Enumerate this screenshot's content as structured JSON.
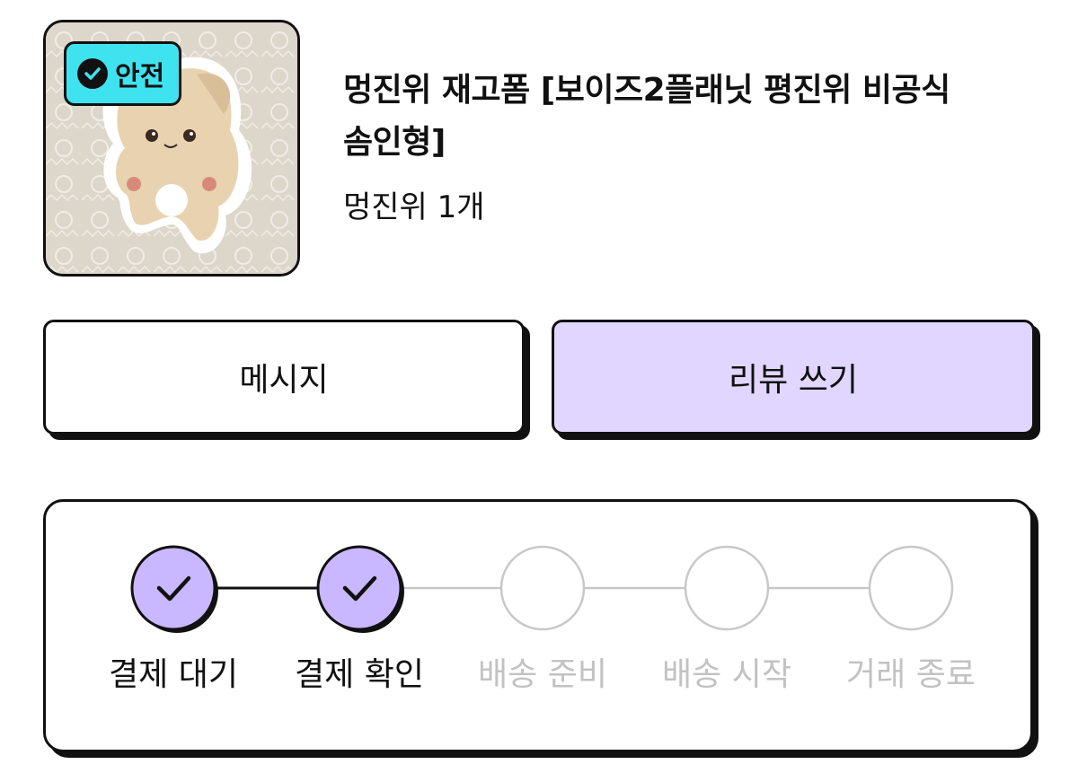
{
  "product": {
    "badge": "안전",
    "title_line1": "멍진위 재고폼 [보이즈2플래닛 평진위 비공식",
    "title_line2": "솜인형]",
    "seller_qty": "멍진위 1개"
  },
  "actions": {
    "message_label": "메시지",
    "review_label": "리뷰 쓰기"
  },
  "progress": {
    "steps": [
      {
        "label": "결제 대기",
        "done": true
      },
      {
        "label": "결제 확인",
        "done": true
      },
      {
        "label": "배송 준비",
        "done": false
      },
      {
        "label": "배송 시작",
        "done": false
      },
      {
        "label": "거래 종료",
        "done": false
      }
    ]
  },
  "colors": {
    "accent": "#c9b8ff",
    "button_review_bg": "#e0d6ff",
    "badge_bg": "#3fe3f0",
    "inactive": "#c8c8c8"
  }
}
